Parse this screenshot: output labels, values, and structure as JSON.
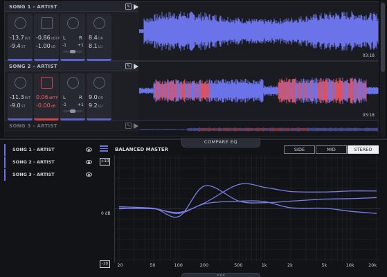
{
  "tracks": [
    {
      "title": "SONG 1 - ARTIST",
      "loudness": {
        "int": "-13.7",
        "int_unit": "INT",
        "st": "-9.4",
        "st_unit": "ST"
      },
      "peak": {
        "tp": "-0.86",
        "tp_unit": "dBTP",
        "db": "-1.00",
        "db_unit": "dB",
        "clipping": false
      },
      "pan": {
        "left": "L",
        "right": "R",
        "min": "-1",
        "max": "+1",
        "position": 0.5
      },
      "dynamics": {
        "dr": "8.4",
        "dr_unit": "DR",
        "lu": "8.1",
        "lu_unit": "LU"
      },
      "duration": "03:18",
      "wave_color": "#6b73e8"
    },
    {
      "title": "SONG 2 - ARTIST",
      "loudness": {
        "int": "-11.3",
        "int_unit": "INT",
        "st": "-9.0",
        "st_unit": "ST"
      },
      "peak": {
        "tp": "0.06",
        "tp_unit": "dBTP",
        "db": "-0.00",
        "db_unit": "dB",
        "clipping": true
      },
      "pan": {
        "left": "L",
        "right": "R",
        "min": "-1",
        "max": "+1",
        "position": 0.5
      },
      "dynamics": {
        "dr": "9.0",
        "dr_unit": "DR",
        "lu": "9.2",
        "lu_unit": "LU"
      },
      "duration": "03:18",
      "wave_color": "#6b73e8"
    },
    {
      "title": "SONG 3 - ARTIST"
    }
  ],
  "eq": {
    "compare_tab": "COMPARE EQ",
    "title": "BALANCED MASTER",
    "modes": [
      "SIDE",
      "MID",
      "STEREO"
    ],
    "active_mode": "STEREO",
    "db_top": "+10",
    "db_mid": "0 dB",
    "db_bottom": "-10",
    "songs": [
      "SONG 1 - ARTIST",
      "SONG 2 - ARTIST",
      "SONG 3 - ARTIST"
    ],
    "freq_labels": [
      "20",
      "50",
      "100",
      "200",
      "500",
      "1k",
      "2k",
      "5k",
      "10k",
      "20k"
    ],
    "bottom_tab": "▾ ▾ ▾"
  },
  "chart_data": {
    "type": "line",
    "x": [
      20,
      50,
      100,
      200,
      500,
      1000,
      2000,
      5000,
      10000,
      20000
    ],
    "ylim": [
      -10,
      10
    ],
    "series": [
      {
        "values": [
          0.1,
          0.0,
          -0.7,
          1.2,
          4.8,
          4.2,
          3.4,
          3.3,
          3.5,
          3.5
        ]
      },
      {
        "values": [
          0.0,
          0.1,
          -1.5,
          4.5,
          1.5,
          1.2,
          1.5,
          1.9,
          2.0,
          2.2
        ]
      },
      {
        "values": [
          0.4,
          0.1,
          -0.9,
          1.0,
          1.5,
          1.4,
          0.2,
          0.1,
          -0.5,
          -0.9
        ]
      }
    ],
    "grid": true,
    "colors": {
      "line": "#7a80e6"
    }
  }
}
